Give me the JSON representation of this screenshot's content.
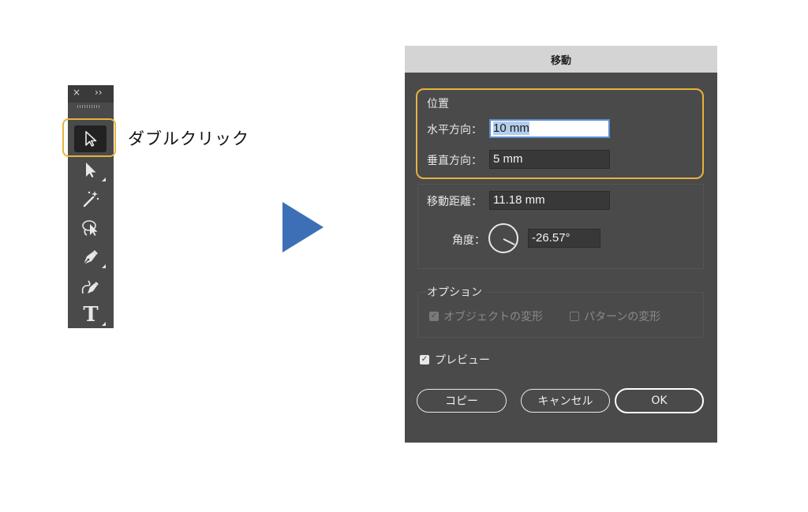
{
  "toolbar": {
    "close_glyph": "×",
    "expand_glyph": "››",
    "tools": [
      {
        "name": "selection-tool",
        "icon": "arrow-outline-icon",
        "selected": true
      },
      {
        "name": "direct-selection-tool",
        "icon": "arrow-filled-icon"
      },
      {
        "name": "magic-wand-tool",
        "icon": "magic-wand-icon"
      },
      {
        "name": "lasso-tool",
        "icon": "lasso-icon"
      },
      {
        "name": "pen-tool",
        "icon": "pen-icon"
      },
      {
        "name": "curvature-tool",
        "icon": "curvature-pen-icon"
      },
      {
        "name": "type-tool",
        "icon": "type-icon",
        "glyph": "T"
      }
    ]
  },
  "callout": {
    "text": "ダブルクリック"
  },
  "colors": {
    "highlight": "#e7b23d",
    "arrow": "#3d6fb6",
    "dialog_bg": "#4a4a4a",
    "titlebar_bg": "#d4d4d4"
  },
  "dialog": {
    "title": "移動",
    "position": {
      "legend": "位置",
      "horizontal_label": "水平方向：",
      "horizontal_value": "10 mm",
      "vertical_label": "垂直方向：",
      "vertical_value": "5 mm"
    },
    "distance_label": "移動距離：",
    "distance_value": "11.18 mm",
    "angle_label": "角度：",
    "angle_value": "-26.57°",
    "options": {
      "legend": "オプション",
      "transform_objects": "オブジェクトの変形",
      "transform_patterns": "パターンの変形"
    },
    "preview_label": "プレビュー",
    "buttons": {
      "copy": "コピー",
      "cancel": "キャンセル",
      "ok": "OK"
    }
  }
}
